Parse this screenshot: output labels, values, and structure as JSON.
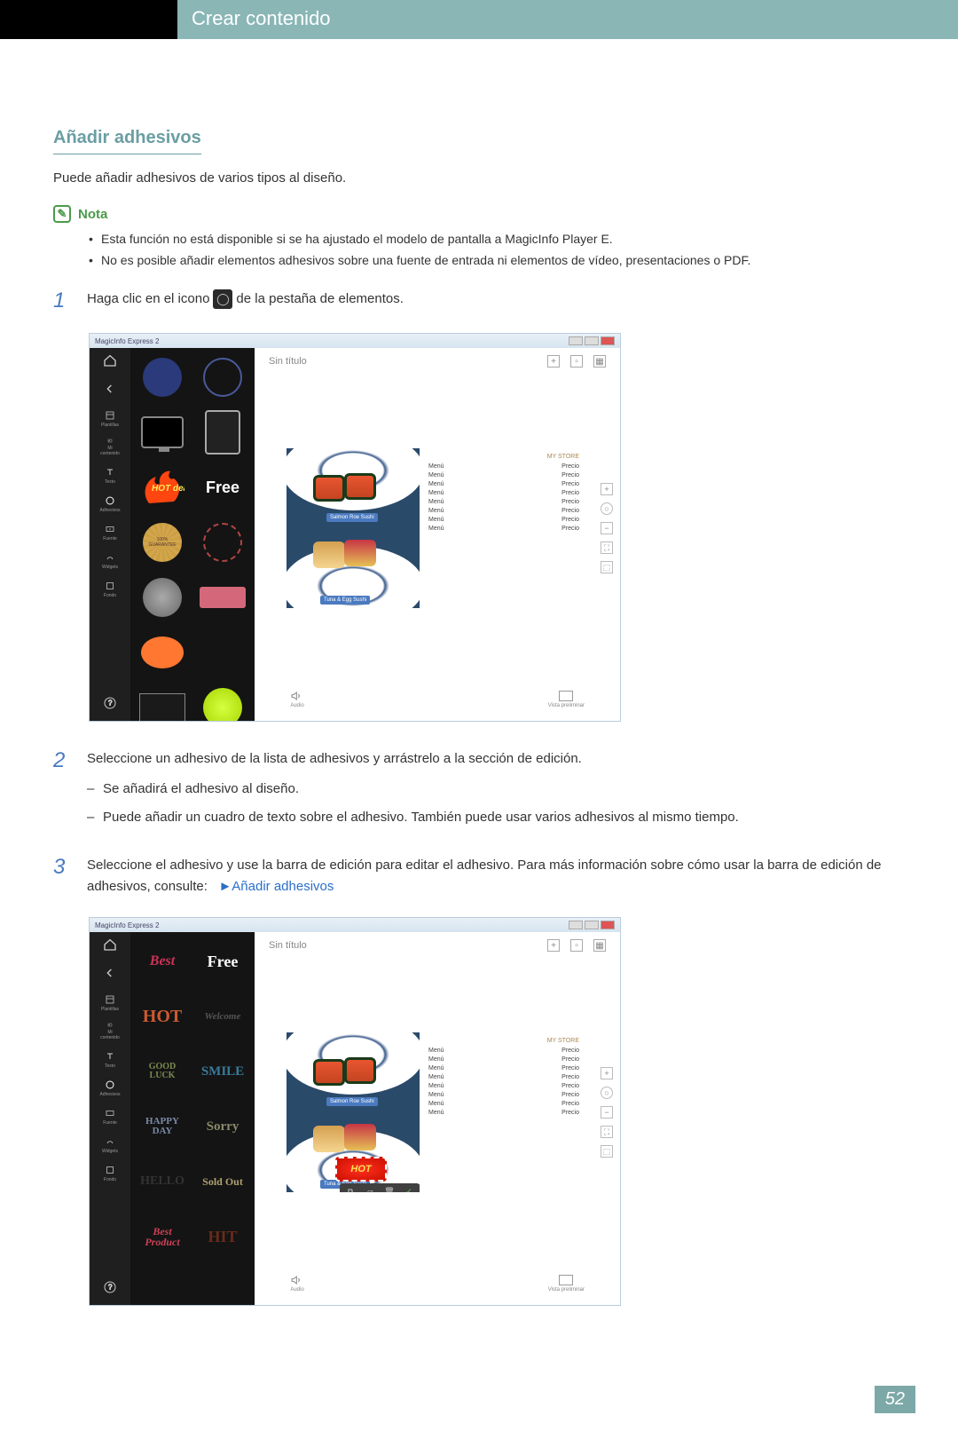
{
  "header": {
    "title": "Crear contenido"
  },
  "section": {
    "heading": "Añadir adhesivos",
    "intro": "Puede añadir adhesivos de varios tipos al diseño."
  },
  "note": {
    "label": "Nota",
    "items": [
      "Esta función no está disponible si se ha ajustado el modelo de pantalla a MagicInfo Player E.",
      "No es posible añadir elementos adhesivos sobre una fuente de entrada ni elementos de vídeo, presentaciones o PDF."
    ]
  },
  "steps": {
    "s1": {
      "num": "1",
      "text_a": "Haga clic en el icono",
      "text_b": "de la pestaña de elementos."
    },
    "s2": {
      "num": "2",
      "text": "Seleccione un adhesivo de la lista de adhesivos y arrástrelo a la sección de edición.",
      "sub": [
        "Se añadirá el adhesivo al diseño.",
        "Puede añadir un cuadro de texto sobre el adhesivo. También puede usar varios adhesivos al mismo tiempo."
      ]
    },
    "s3": {
      "num": "3",
      "text": "Seleccione el adhesivo y use la barra de edición para editar el adhesivo. Para más información sobre cómo usar la barra de edición de adhesivos, consulte:",
      "link_prefix": "►",
      "link": "Añadir adhesivos"
    }
  },
  "app": {
    "title": "MagicInfo Express 2",
    "canvas_title": "Sin título",
    "store": "MY STORE",
    "menu_label": "Menú",
    "price_label": "Precio",
    "sushi_label_1": "Salmon Roe Sushi",
    "sushi_label_2": "Tuna & Egg Sushi",
    "footer_audio": "Audio",
    "footer_preview": "Vista preliminar",
    "sidebar": {
      "plantillas": "Plantillas",
      "micontent": "Mi contenido",
      "texto": "Texto",
      "adhesivos": "Adhesivos",
      "fuente": "Fuente",
      "widgets": "Widgets",
      "fondo": "Fondo"
    },
    "hot_overlay": "HOT"
  },
  "stickers_text": {
    "best": "Best",
    "free": "Free",
    "hot": "HOT",
    "welcome": "Welcome",
    "goodluck": "GOOD\nLUCK",
    "smile": "SMILE",
    "happyday": "HAPPY\nDAY",
    "sorry": "Sorry",
    "hello": "HELLO",
    "soldout": "Sold Out",
    "bestproduct": "Best\nProduct",
    "hit": "HIT",
    "hotdeal": "HOT\ndeal"
  },
  "page_number": "52"
}
